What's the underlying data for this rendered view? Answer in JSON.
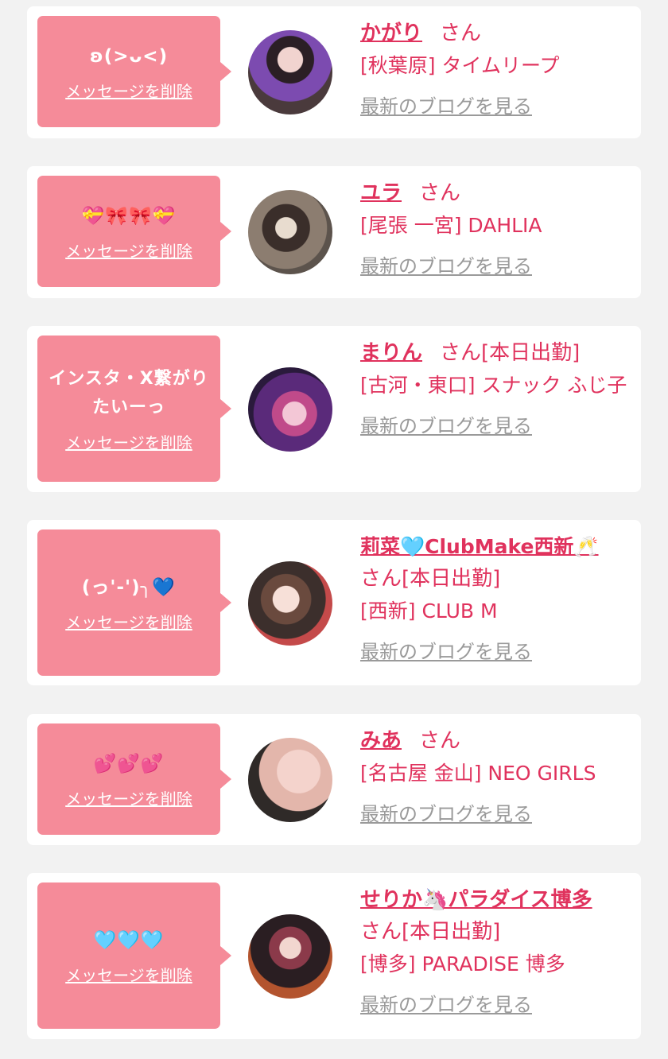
{
  "delete_label": "メッセージを削除",
  "blog_label": "最新のブログを見る",
  "accent_color": "#e0325d",
  "bubble_color": "#f58b99",
  "cards": [
    {
      "message": "ʚ(>ᴗ<)",
      "name": "かがり",
      "honorific": "さん",
      "status": "",
      "shop": "[秋葉原] タイムリープ"
    },
    {
      "message": "💝🎀🎀💝",
      "name": "ユラ",
      "honorific": "さん",
      "status": "",
      "shop": "[尾張 一宮] DAHLIA"
    },
    {
      "message": "インスタ・X繋がりたいーっ",
      "name": "まりん",
      "honorific": "さん",
      "status": "[本日出勤]",
      "shop": "[古河・東口] スナック ふじ子"
    },
    {
      "message": "(っ'-')╮💙",
      "name": "莉菜🩵ClubMake西新🥂",
      "honorific": "さん",
      "status": "[本日出勤]",
      "shop": "[西新] CLUB M"
    },
    {
      "message": "💕💕💕",
      "name": "みあ",
      "honorific": "さん",
      "status": "",
      "shop": "[名古屋 金山] NEO GIRLS"
    },
    {
      "message": "🩵🩵🩵",
      "name": "せりか🦄パラダイス博多",
      "honorific": "さん",
      "status": "[本日出勤]",
      "shop": "[博多] PARADISE 博多"
    }
  ]
}
